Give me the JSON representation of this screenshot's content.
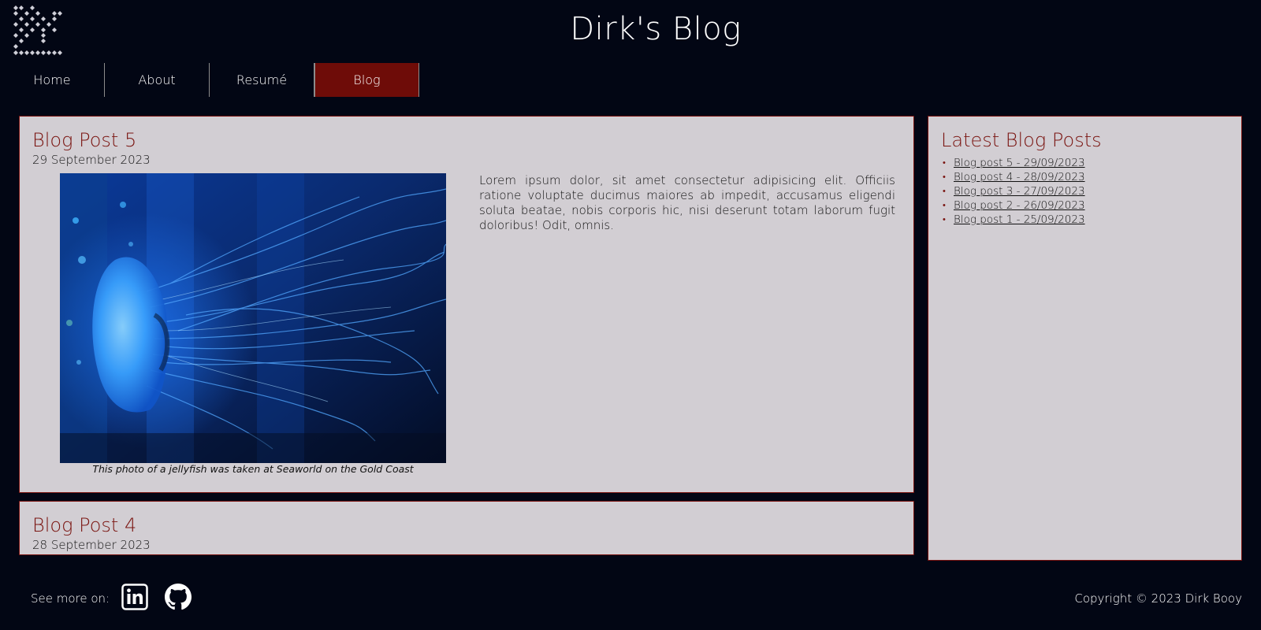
{
  "header": {
    "title": "Dirk's Blog"
  },
  "nav": {
    "items": [
      {
        "label": "Home"
      },
      {
        "label": "About"
      },
      {
        "label": "Resumé"
      },
      {
        "label": "Blog",
        "active": true
      }
    ]
  },
  "posts": [
    {
      "title": "Blog Post 5",
      "date": "29 September 2023",
      "caption": "This photo of a jellyfish was taken at Seaworld on the Gold Coast",
      "body": "Lorem ipsum dolor, sit amet consectetur adipisicing elit. Officiis ratione voluptate ducimus maiores ab impedit, accusamus eligendi soluta beatae, nobis corporis hic, nisi deserunt totam laborum fugit doloribus! Odit, omnis."
    },
    {
      "title": "Blog Post 4",
      "date": "28 September 2023"
    }
  ],
  "sidebar": {
    "title": "Latest Blog Posts",
    "links": [
      {
        "label": "Blog post 5 - 29/09/2023"
      },
      {
        "label": "Blog post 4 - 28/09/2023"
      },
      {
        "label": "Blog post 3 - 27/09/2023"
      },
      {
        "label": "Blog post 2 - 26/09/2023"
      },
      {
        "label": "Blog post 1 - 25/09/2023"
      }
    ]
  },
  "footer": {
    "see_more": "See more on:",
    "icons": [
      "linkedin-icon",
      "github-icon"
    ],
    "copyright": "Copyright © 2023 Dirk Booy"
  },
  "colors": {
    "background": "#020614",
    "accent": "#7a1410",
    "nav_active": "#6e0c08",
    "card": "#d2ced3"
  }
}
